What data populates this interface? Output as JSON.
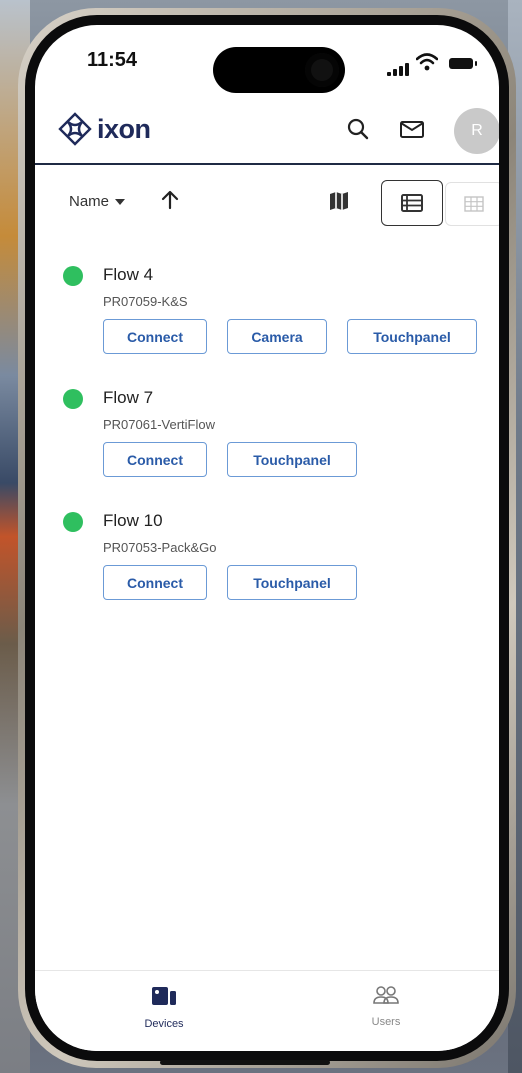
{
  "status_bar": {
    "time": "11:54"
  },
  "header": {
    "logo_text": "ixon",
    "avatar_initial": "R"
  },
  "toolbar": {
    "sort_field": "Name"
  },
  "devices": [
    {
      "name": "Flow 4",
      "serial": "PR07059-K&S",
      "online": true,
      "actions": [
        "Connect",
        "Camera",
        "Touchpanel"
      ]
    },
    {
      "name": "Flow 7",
      "serial": "PR07061-VertiFlow",
      "online": true,
      "actions": [
        "Connect",
        "Touchpanel"
      ]
    },
    {
      "name": "Flow 10",
      "serial": "PR07053-Pack&Go",
      "online": true,
      "actions": [
        "Connect",
        "Touchpanel"
      ]
    }
  ],
  "bottom_nav": {
    "devices_label": "Devices",
    "users_label": "Users"
  },
  "colors": {
    "brand": "#1f2a5a",
    "online": "#2fbf5f",
    "button_border": "#6b9ad6",
    "button_text": "#2a5ba8"
  },
  "icons": {
    "search": "search-icon",
    "mail": "mail-icon",
    "sort_direction": "arrow-up-icon",
    "map": "map-icon",
    "list_view": "list-view-icon",
    "grid_view": "grid-view-icon",
    "devices": "devices-icon",
    "users": "users-icon"
  }
}
